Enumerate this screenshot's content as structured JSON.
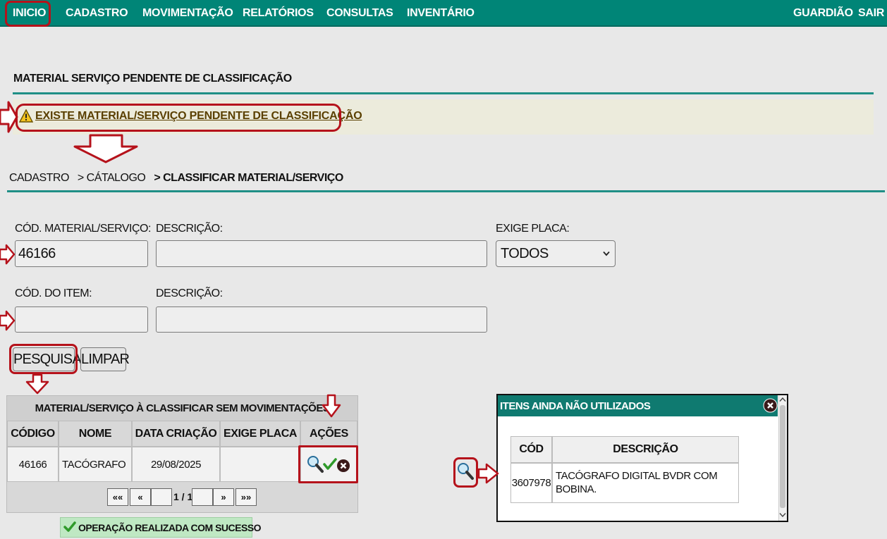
{
  "nav": {
    "items": [
      "INICIO",
      "CADASTRO",
      "MOVIMENTAÇÃO",
      "RELATÓRIOS",
      "CONSULTAS",
      "INVENTÁRIO"
    ],
    "right": [
      "GUARDIÃO",
      "SAIR"
    ]
  },
  "pending": {
    "title": "MATERIAL SERVIÇO PENDENTE DE CLASSIFICAÇÃO",
    "alert": "EXISTE MATERIAL/SERVIÇO PENDENTE DE CLASSIFICAÇÃO"
  },
  "breadcrumb": {
    "level1": "CADASTRO",
    "level2": "> CÁTALOGO",
    "current": "> CLASSIFICAR MATERIAL/SERVIÇO"
  },
  "form": {
    "cod_material_label": "CÓD. MATERIAL/SERVIÇO:",
    "cod_material_value": "46166",
    "descricao1_label": "DESCRIÇÃO:",
    "descricao1_value": "",
    "exige_placa_label": "EXIGE PLACA:",
    "exige_placa_value": "TODOS",
    "cod_item_label": "CÓD. DO ITEM:",
    "cod_item_value": "",
    "descricao2_label": "DESCRIÇÃO:",
    "descricao2_value": "",
    "search_button": "PESQUISAR",
    "clear_button": "LIMPAR"
  },
  "results": {
    "title": "MATERIAL/SERVIÇO À CLASSIFICAR SEM MOVIMENTAÇÕES",
    "columns": [
      "CÓDIGO",
      "NOME",
      "DATA CRIAÇÃO",
      "EXIGE PLACA",
      "AÇÕES"
    ],
    "rows": [
      {
        "codigo": "46166",
        "nome": "TACÓGRAFO",
        "data": "29/08/2025",
        "exige_placa": ""
      }
    ],
    "pagination": {
      "first": "««",
      "prev": "«",
      "page": "1 / 1",
      "next": "»",
      "last": "»»"
    }
  },
  "success_message": "OPERAÇÃO REALIZADA COM SUCESSO",
  "popup": {
    "title": "ITENS AINDA NÃO UTILIZADOS",
    "columns": [
      "CÓD",
      "DESCRIÇÃO"
    ],
    "rows": [
      {
        "cod": "3607978",
        "descricao_line1": "TACÓGRAFO DIGITAL BVDR COM",
        "descricao_line2": "BOBINA."
      }
    ]
  },
  "colors": {
    "nav_bg": "#008577",
    "annotation_red": "#b5121b",
    "alert_bg": "#ecebdc",
    "success_bg": "#bfe8c3"
  },
  "icons": [
    "warning-icon",
    "search-icon",
    "check-icon",
    "close-icon",
    "chevron-down-icon",
    "arrow-annotation"
  ]
}
